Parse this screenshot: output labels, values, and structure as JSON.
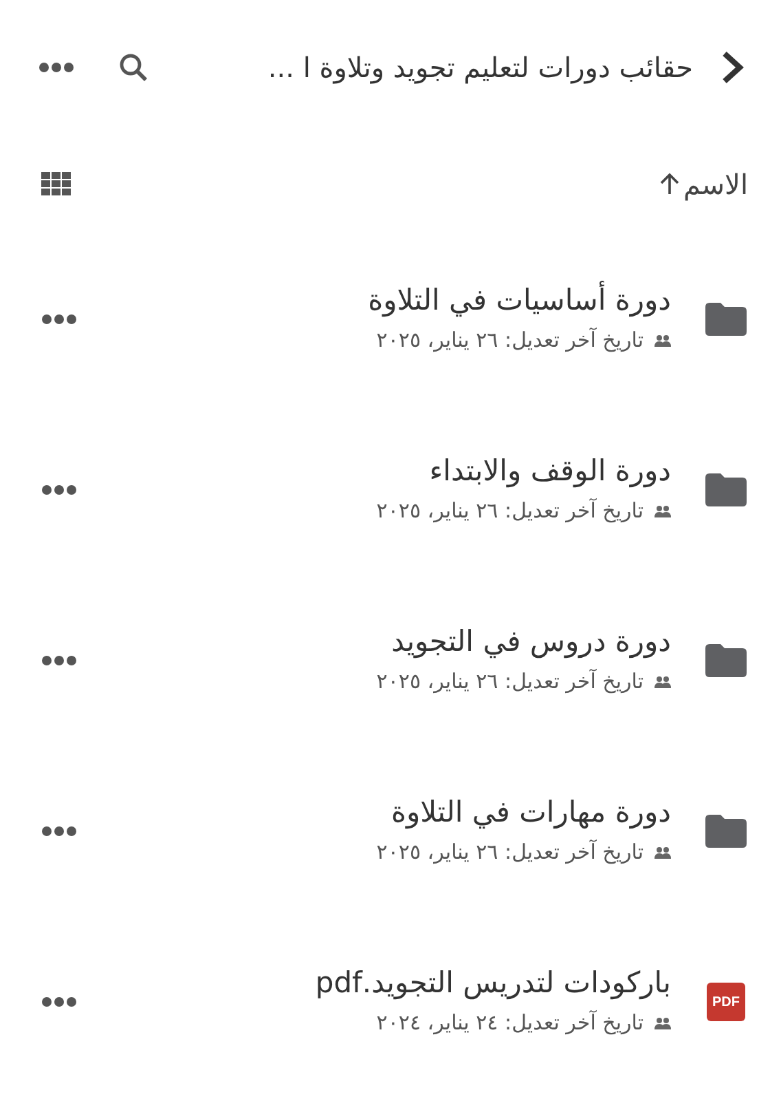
{
  "header": {
    "title": "حقائب دورات لتعليم تجويد وتلاوة ا ..."
  },
  "sort": {
    "label": "الاسم",
    "ascending": true
  },
  "files": [
    {
      "kind": "folder",
      "name": "دورة أساسيات في التلاوة",
      "modified": "تاريخ آخر تعديل: ٢٦ يناير، ٢٠٢٥",
      "shared": true
    },
    {
      "kind": "folder",
      "name": "دورة الوقف والابتداء",
      "modified": "تاريخ آخر تعديل: ٢٦ يناير، ٢٠٢٥",
      "shared": true
    },
    {
      "kind": "folder",
      "name": "دورة دروس في التجويد",
      "modified": "تاريخ آخر تعديل: ٢٦ يناير، ٢٠٢٥",
      "shared": true
    },
    {
      "kind": "folder",
      "name": "دورة مهارات في التلاوة",
      "modified": "تاريخ آخر تعديل: ٢٦ يناير، ٢٠٢٥",
      "shared": true
    },
    {
      "kind": "pdf",
      "badge": "PDF",
      "name": "باركودات لتدريس التجويد.pdf",
      "modified": "تاريخ آخر تعديل: ٢٤ يناير، ٢٠٢٤",
      "shared": true
    }
  ]
}
